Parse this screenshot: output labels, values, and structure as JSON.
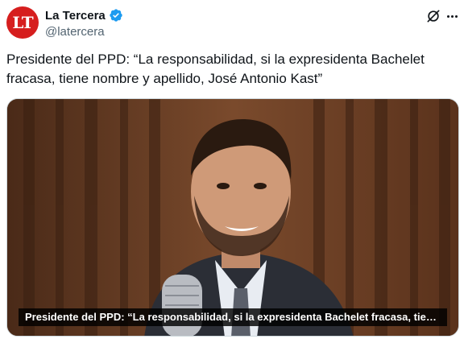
{
  "account": {
    "display_name": "La Tercera",
    "handle": "@latercera",
    "avatar_text": "LT",
    "avatar_color": "#d61e1e",
    "verified": true,
    "verified_color": "#1d9bf0"
  },
  "tweet": {
    "text": "Presidente del PPD: “La responsabilidad, si la expresidenta Bachelet fracasa, tiene nombre y apellido, José Antonio Kast”"
  },
  "media": {
    "caption": "Presidente del PPD: “La responsabilidad, si la expresidenta Bachelet fracasa, tiene no..."
  },
  "icons": {
    "verified": "verified-badge-icon",
    "grok": "grok-icon",
    "more": "more-options-icon"
  }
}
